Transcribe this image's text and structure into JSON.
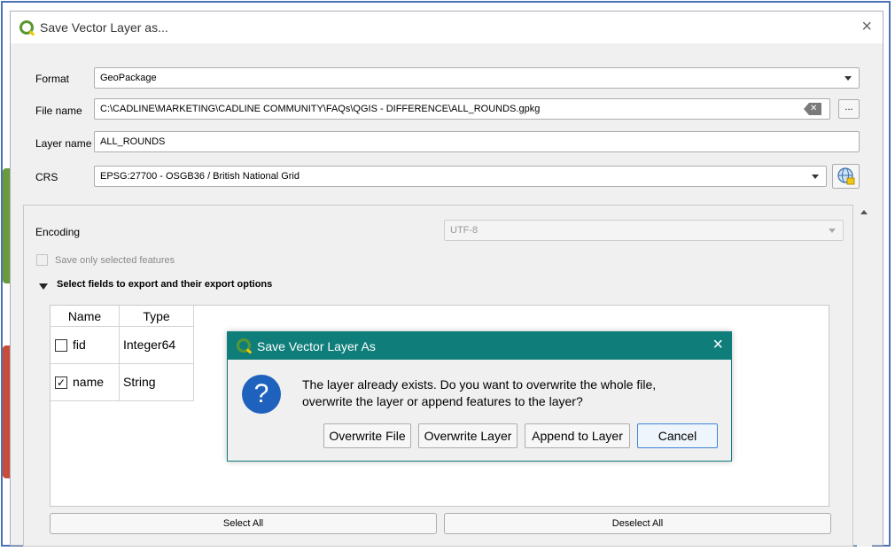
{
  "window": {
    "title": "Save Vector Layer as..."
  },
  "form": {
    "format_label": "Format",
    "format_value": "GeoPackage",
    "filename_label": "File name",
    "filename_value": "C:\\CADLINE\\MARKETING\\CADLINE COMMUNITY\\FAQs\\QGIS - DIFFERENCE\\ALL_ROUNDS.gpkg",
    "browse_label": "...",
    "layername_label": "Layer name",
    "layername_value": "ALL_ROUNDS",
    "crs_label": "CRS",
    "crs_value": "EPSG:27700 - OSGB36 / British National Grid"
  },
  "options": {
    "encoding_label": "Encoding",
    "encoding_value": "UTF-8",
    "selected_only_label": "Save only selected features",
    "fields_section_label": "Select fields to export and their export options",
    "columns": [
      "Name",
      "Type"
    ],
    "rows": [
      {
        "name": "fid",
        "type": "Integer64",
        "checked": false
      },
      {
        "name": "name",
        "type": "String",
        "checked": true
      }
    ],
    "select_all_label": "Select All",
    "deselect_all_label": "Deselect All"
  },
  "modal": {
    "title": "Save Vector Layer As",
    "message_line1": "The layer already exists. Do you want to overwrite the whole file,",
    "message_line2": "overwrite the layer or append features to the layer?",
    "buttons": {
      "overwrite_file": "Overwrite File",
      "overwrite_layer": "Overwrite Layer",
      "append_layer": "Append to Layer",
      "cancel": "Cancel"
    },
    "icon": "question-icon"
  },
  "colors": {
    "modal_titlebar": "#0f7e7a",
    "question_icon": "#1f62bd",
    "qgis_green": "#589632",
    "qgis_yellow": "#eec900"
  }
}
